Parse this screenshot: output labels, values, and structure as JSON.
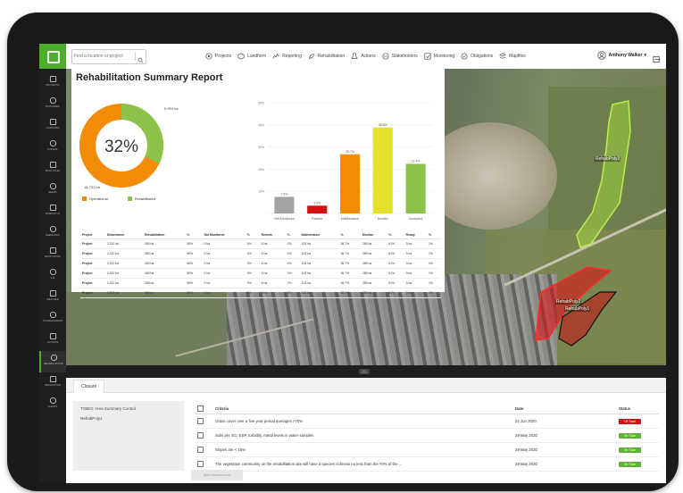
{
  "colors": {
    "brand_green": "#4caf2b",
    "operational": "#f28b05",
    "rehabilitated": "#8bc34a",
    "not_monitored": "#a3a3a3",
    "rework": "#d50f0f",
    "maintenance": "#f28b05",
    "monitor": "#e6e02d",
    "accepted": "#8bc34a",
    "off_track": "#d50f0f",
    "on_track": "#5ab531"
  },
  "search": {
    "placeholder": "Find a location or project"
  },
  "nav": [
    {
      "label": "Projects",
      "icon": "projects-icon"
    },
    {
      "label": "Landform",
      "icon": "landform-icon"
    },
    {
      "label": "Reporting",
      "icon": "reporting-icon"
    },
    {
      "label": "Rehabilitation",
      "icon": "rehabilitation-icon"
    },
    {
      "label": "Actions",
      "icon": "actions-icon"
    },
    {
      "label": "Stakeholders",
      "icon": "stakeholders-icon"
    },
    {
      "label": "Monitoring",
      "icon": "monitoring-icon"
    },
    {
      "label": "Obligations",
      "icon": "obligations-icon"
    },
    {
      "label": "Mapfiles",
      "icon": "mapfiles-icon"
    }
  ],
  "user": {
    "name": "Anthony Walker"
  },
  "sidebar": [
    {
      "label": "PROJECTS"
    },
    {
      "label": "DISTURBED"
    },
    {
      "label": "LANDFORM"
    },
    {
      "label": "TOPSOIL"
    },
    {
      "label": "SPOIL PILES"
    },
    {
      "label": "SEEDS"
    },
    {
      "label": "DOMESTICS"
    },
    {
      "label": "SEEDLINGS"
    },
    {
      "label": "MONITORING"
    },
    {
      "label": "GIS"
    },
    {
      "label": "WEATHER"
    },
    {
      "label": "STAKEHOLDERS"
    },
    {
      "label": "ACTIONS"
    },
    {
      "label": "REHABILITATION"
    },
    {
      "label": "OBLIGATIONS"
    },
    {
      "label": "ALERTS"
    }
  ],
  "map": {
    "polygons": [
      {
        "label": "RehabPoly3"
      },
      {
        "label": "RehabPoly2"
      },
      {
        "label": "RehabPoly1"
      }
    ]
  },
  "report": {
    "title": "Rehabilitation Summary Report",
    "donut": {
      "percent_label": "32%",
      "operational_ha": "18,731 ha",
      "rehabilitated_ha": "5,994 ha",
      "rehabilitated_fraction": 0.32,
      "legend_operational": "Operational",
      "legend_rehabilitated": "Rehabilitated"
    },
    "table": {
      "headers": [
        "Project",
        "Disturbance",
        "Rehabilitation",
        "%",
        "Not Monitored",
        "%",
        "Rework",
        "%",
        "Maintenance",
        "%",
        "Monitor",
        "%",
        "Ready",
        "%"
      ],
      "rows": [
        [
          "Project",
          "2,232 ha",
          "350 ha",
          "56%",
          "0 ha",
          "0%",
          "6 ha",
          "2%",
          "102 ha",
          "36.7%",
          "289 ha",
          "61%",
          "3 ha",
          "1%"
        ],
        [
          "Project",
          "2,232 ha",
          "350 ha",
          "56%",
          "0 ha",
          "0%",
          "6 ha",
          "2%",
          "102 ha",
          "36.7%",
          "289 ha",
          "61%",
          "3 ha",
          "1%"
        ],
        [
          "Project",
          "2,232 ha",
          "350 ha",
          "56%",
          "0 ha",
          "0%",
          "6 ha",
          "2%",
          "102 ha",
          "36.7%",
          "289 ha",
          "61%",
          "3 ha",
          "1%"
        ],
        [
          "Project",
          "2,232 ha",
          "350 ha",
          "56%",
          "0 ha",
          "0%",
          "6 ha",
          "2%",
          "102 ha",
          "36.7%",
          "289 ha",
          "61%",
          "3 ha",
          "1%"
        ],
        [
          "Project",
          "2,232 ha",
          "350 ha",
          "56%",
          "0 ha",
          "0%",
          "6 ha",
          "2%",
          "102 ha",
          "36.7%",
          "289 ha",
          "61%",
          "3 ha",
          "1%"
        ],
        [
          "Project",
          "2,232 ha",
          "350 ha",
          "56%",
          "0 ha",
          "0%",
          "6 ha",
          "2%",
          "102 ha",
          "36.7%",
          "289 ha",
          "61%",
          "3 ha",
          "1%"
        ]
      ]
    }
  },
  "chart_data": {
    "type": "bar",
    "categories": [
      "Not Monitored",
      "Rework",
      "Maintenance",
      "Monitor",
      "Accepted"
    ],
    "values": [
      7.5,
      3.5,
      26.7,
      38.8,
      22.4
    ],
    "value_labels": [
      "7.5%",
      "3.5%",
      "26.7%",
      "38.8%",
      "22.4%"
    ],
    "y_ticks": [
      "50%",
      "40%",
      "30%",
      "20%",
      "10%",
      ""
    ],
    "ylim": [
      0,
      50
    ],
    "grid": true,
    "legend": "none"
  },
  "bottom": {
    "tab": "Closure",
    "left_list": [
      "TOBIO: Area Summary Control",
      "RehabPoly1"
    ],
    "criteria_headers": [
      "Criteria",
      "Date",
      "Status"
    ],
    "criteria": [
      {
        "text": "Grass cover over a five year period averages >70%",
        "date": "24 Jun 2020",
        "status": "Off Track",
        "status_color": "#d50f0f"
      },
      {
        "text": "Soils pH, EC, ESP, turbidity, metal levels in water samples",
        "date": "28 May 2020",
        "status": "On Track",
        "status_color": "#5ab531"
      },
      {
        "text": "Slopes are < 15%",
        "date": "28 May 2020",
        "status": "On Track",
        "status_color": "#5ab531"
      },
      {
        "text": "The vegetation community on the rehabilitation site will have a species richness no less than the 70% of the ...",
        "date": "28 May 2020",
        "status": "On Track",
        "status_color": "#5ab531"
      }
    ],
    "add_button": "Add Assessment"
  }
}
